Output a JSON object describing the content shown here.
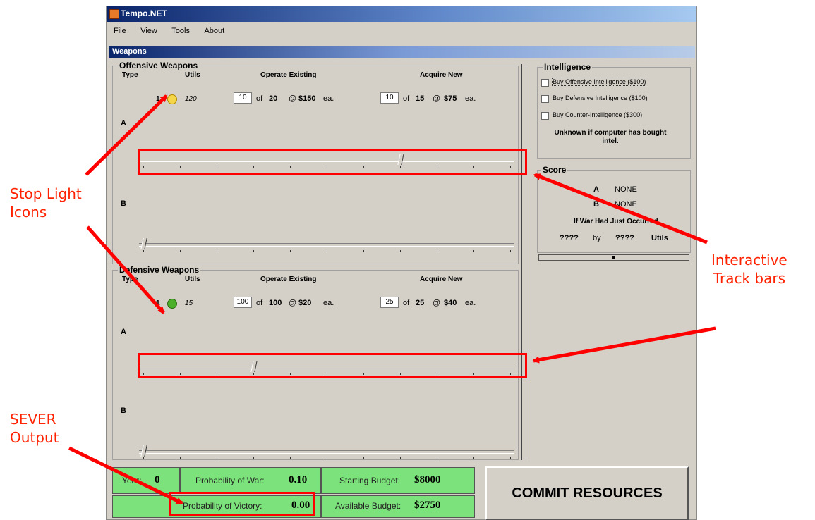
{
  "window": {
    "title": "Tempo.NET"
  },
  "menu": [
    "File",
    "View",
    "Tools",
    "About"
  ],
  "panel_title": "Weapons",
  "offensive": {
    "title": "Offensive Weapons",
    "headers": {
      "type": "Type",
      "utils": "Utils",
      "operate": "Operate Existing",
      "acquire": "Acquire New"
    },
    "row": {
      "type": "1",
      "light_color": "#f5d54a",
      "utils": "120",
      "operate_value": "10",
      "operate_of": "of",
      "operate_total": "20",
      "operate_at": "@",
      "operate_price": "$150",
      "operate_ea": "ea.",
      "acquire_value": "10",
      "acquire_of": "of",
      "acquire_total": "15",
      "acquire_at": "@",
      "acquire_price": "$75",
      "acquire_ea": "ea."
    },
    "side_a": "A",
    "side_b": "B",
    "track_a_level": 0.7,
    "track_b_level": 0.0
  },
  "defensive": {
    "title": "Defensive Weapons",
    "headers": {
      "type": "Type",
      "utils": "Utils",
      "operate": "Operate Existing",
      "acquire": "Acquire New"
    },
    "row": {
      "type": "1",
      "light_color": "#4caf2a",
      "utils": "15",
      "operate_value": "100",
      "operate_of": "of",
      "operate_total": "100",
      "operate_at": "@",
      "operate_price": "$20",
      "operate_ea": "ea.",
      "acquire_value": "25",
      "acquire_of": "of",
      "acquire_total": "25",
      "acquire_at": "@",
      "acquire_price": "$40",
      "acquire_ea": "ea."
    },
    "side_a": "A",
    "side_b": "B",
    "track_a_level": 0.3,
    "track_b_level": 0.0
  },
  "intelligence": {
    "title": "Intelligence",
    "options": [
      "Buy Offensive Intelligence ($100)",
      "Buy Defensive Intelligence ($100)",
      "Buy Counter-Intelligence ($300)"
    ],
    "status": "Unknown if computer has bought intel."
  },
  "score": {
    "title": "Score",
    "a_label": "A",
    "a_value": "NONE",
    "b_label": "B",
    "b_value": "NONE",
    "war_label": "If War Had Just Occurred",
    "result_left": "????",
    "result_by": "by",
    "result_right": "????",
    "result_units": "Utils"
  },
  "status_bar": {
    "year_label": "Year:",
    "year_value": "0",
    "war_prob_label": "Probability of War:",
    "war_prob_value": "0.10",
    "start_budget_label": "Starting Budget:",
    "start_budget_value": "$8000",
    "victory_label": "Probability of Victory:",
    "victory_value": "0.00",
    "avail_budget_label": "Available Budget:",
    "avail_budget_value": "$2750"
  },
  "commit_label": "COMMIT RESOURCES",
  "annotations": {
    "stop_light_1": "Stop Light",
    "stop_light_2": "Icons",
    "track_1": "Interactive",
    "track_2": "Track bars",
    "sever_1": "SEVER",
    "sever_2": "Output"
  },
  "colors": {
    "annotation": "#ff2200",
    "status_green": "#7ce37c",
    "title_blue": "#0a246a"
  }
}
